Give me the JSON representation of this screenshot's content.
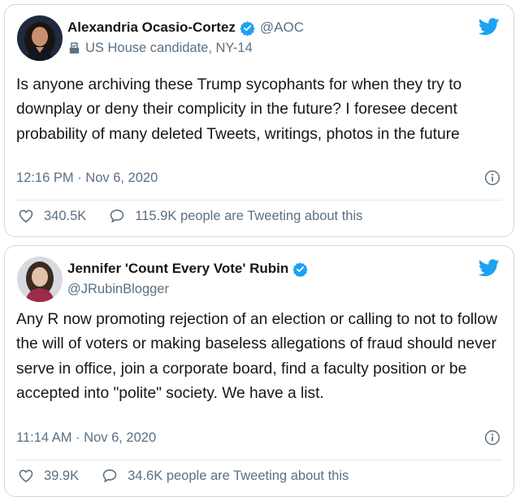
{
  "tweets": [
    {
      "name": "Alexandria Ocasio-Cortez",
      "handle": "@AOC",
      "label": "US House candidate, NY-14",
      "text": "Is anyone archiving these Trump sycophants for when they try to downplay or deny their complicity in the future? I foresee decent probability of many deleted Tweets, writings, photos in the future",
      "time": "12:16 PM · Nov 6, 2020",
      "likes": "340.5K",
      "tweeting": "115.9K people are Tweeting about this"
    },
    {
      "name": "Jennifer 'Count Every Vote' Rubin",
      "handle": "@JRubinBlogger",
      "text": "Any R now promoting rejection of an election or calling to not to follow the will of voters or making baseless allegations of fraud should never serve in office, join a corporate board, find a faculty position or be accepted into \"polite\" society. We have a list.",
      "time": "11:14 AM · Nov 6, 2020",
      "likes": "39.9K",
      "tweeting": "34.6K people are Tweeting about this"
    }
  ],
  "icons": {
    "twitter": "twitter-bird-icon",
    "verified": "verified-badge-icon",
    "ballot": "ballot-box-icon",
    "info": "info-icon",
    "heart": "heart-icon",
    "comment": "speech-bubble-icon"
  },
  "colors": {
    "twitter_blue": "#1da1f2",
    "text": "#14171a",
    "secondary": "#5b7083",
    "border": "#cfd9de"
  }
}
